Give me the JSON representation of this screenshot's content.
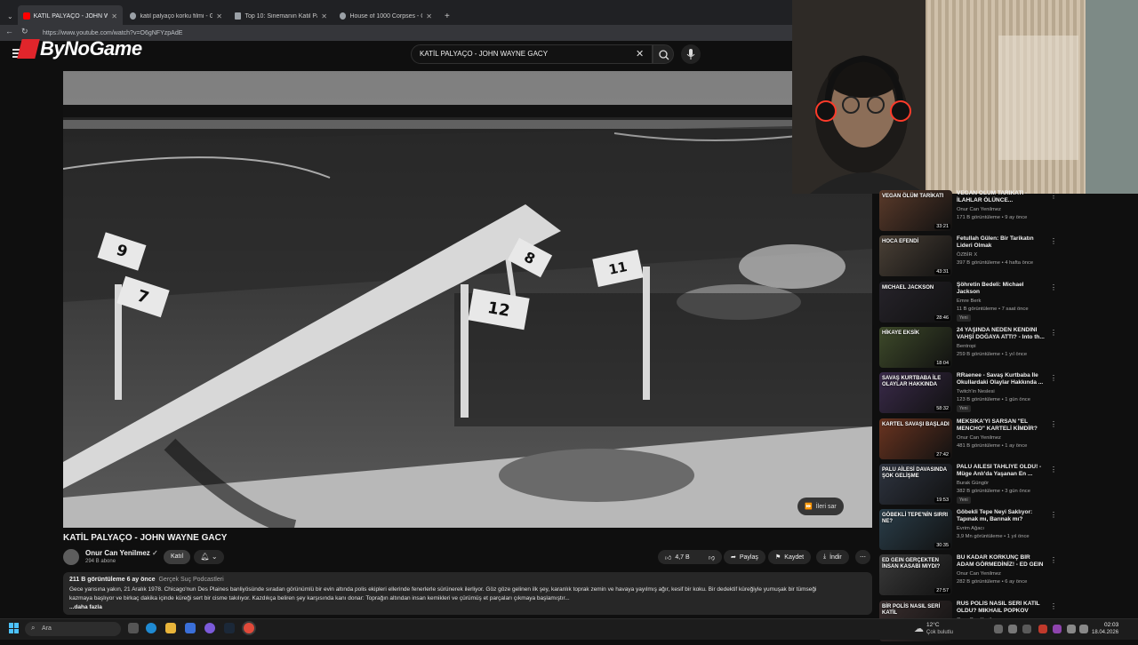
{
  "browser": {
    "tabs": [
      {
        "label": "KATİL PALYAÇO - JOHN WAYNE G",
        "active": true,
        "icon": "youtube-icon"
      },
      {
        "label": "katil palyaço korku filmi - Google",
        "active": false,
        "icon": "google-icon"
      },
      {
        "label": "Top 10: Sinemanın Katil Palyaçola",
        "active": false,
        "icon": "page-icon"
      },
      {
        "label": "House of 1000 Corpses - Google",
        "active": false,
        "icon": "google-icon"
      }
    ],
    "url": "https://www.youtube.com/watch?v=O6gNFYzpAdE"
  },
  "header": {
    "logo_text": "ByNoGame",
    "search_query": "KATİL PALYAÇO - JOHN WAYNE GACY"
  },
  "video": {
    "markers": [
      "9",
      "7",
      "8",
      "12",
      "11"
    ],
    "skip_label": "İleri sar",
    "title": "KATİL PALYAÇO - JOHN WAYNE GACY"
  },
  "channel": {
    "name": "Onur Can Yenilmez",
    "subscribers": "294 B abone",
    "join_label": "Katıl"
  },
  "actions": {
    "likes": "4,7 B",
    "share": "Paylaş",
    "save": "Kaydet",
    "download": "İndir"
  },
  "description": {
    "views_time": "211 B görüntüleme  6 ay önce",
    "tag": "Gerçek Suç Podcastleri",
    "line1": "Gece yarısına yakın, 21 Aralık 1978. Chicago'nun Des Plaines banliyösünde sıradan görünümlü bir evin altında polis ekipleri ellerinde fenerlerle sürünerek ilerliyor. Göz göze gelinen ilk şey, karanlık toprak zemin ve havaya yayılmış ağır, kesif bir koku. Bir dedektif küreğiyle yumuşak bir tümseği",
    "line2": "kazmaya başlıyor ve birkaç dakika içinde küreği sert bir cisme takılıyor. Kazdıkça beliren şey karşısında kanı donar: Toprağın altından insan kemikleri ve çürümüş et parçaları çıkmaya başlamıştır...",
    "more": "...daha fazla"
  },
  "recommendations": [
    {
      "title": "VEGAN ÖLÜM TARİKATI - İLAHLAR ÖLÜNCE...",
      "thumb_text": "VEGAN ÖLÜM TARİKATI",
      "channel": "Onur Can Yenilmez",
      "meta": "171 B görüntüleme • 9 ay önce",
      "duration": "33:21",
      "new": "",
      "color": "#5a3a2a"
    },
    {
      "title": "Fetullah Gülen: Bir Tarikatın Lideri Olmak",
      "thumb_text": "HOCA EFENDİ",
      "channel": "ÖZBİR X",
      "meta": "397 B görüntüleme • 4 hafta önce",
      "duration": "43:31",
      "new": "",
      "color": "#4a4036"
    },
    {
      "title": "Şöhretin Bedeli: Michael Jackson",
      "thumb_text": "MICHAEL JACKSON",
      "channel": "Emre Berk",
      "meta": "11 B görüntüleme • 7 saat önce",
      "duration": "28:46",
      "new": "Yeni",
      "color": "#26232a"
    },
    {
      "title": "24 YAŞINDA NEDEN KENDİNİ VAHŞİ DOĞAYA ATTI? - Into th...",
      "thumb_text": "HİKAYE EKSİK",
      "channel": "Bentropi",
      "meta": "259 B görüntüleme • 1 yıl önce",
      "duration": "18:04",
      "new": "",
      "color": "#3e4a2a"
    },
    {
      "title": "RRaenee - Savaş Kurtbaba İle Okullardaki Olaylar Hakkında ...",
      "thumb_text": "SAVAŞ KURTBABA İLE OLAYLAR HAKKINDA",
      "channel": "Twitch'in Neslesi",
      "meta": "123 B görüntüleme • 1 gün önce",
      "duration": "58:32",
      "new": "Yeni",
      "color": "#3a2a4a"
    },
    {
      "title": "MEKSİKA'YI SARSAN \"EL MENCHO\" KARTELİ KİMDİR?",
      "thumb_text": "KARTEL SAVAŞI BAŞLADI",
      "channel": "Onur Can Yenilmez",
      "meta": "481 B görüntüleme • 1 ay önce",
      "duration": "27:42",
      "new": "",
      "color": "#6a3420"
    },
    {
      "title": "PALU AİLESİ TAHLİYE OLDU! - Müge Anlı'da Yaşanan En ...",
      "thumb_text": "PALU AİLESİ DAVASINDA ŞOK GELİŞME",
      "channel": "Burak Güngör",
      "meta": "382 B görüntüleme • 3 gün önce",
      "duration": "19:53",
      "new": "Yeni",
      "color": "#2e3440"
    },
    {
      "title": "Göbekli Tepe Neyi Saklıyor: Tapınak mı, Barınak mı?",
      "thumb_text": "GÖBEKLİ TEPE'NİN SIRRI NE?",
      "channel": "Evrim Ağacı",
      "meta": "3,9 Mn görüntüleme • 1 yıl önce",
      "duration": "30:35",
      "new": "",
      "color": "#2a3e4a"
    },
    {
      "title": "BU KADAR KORKUNÇ BİR ADAM GÖRMEDİNİZ! - ED GEIN",
      "thumb_text": "ED GEIN GERÇEKTEN İNSAN KASABI MIYDI?",
      "channel": "Onur Can Yenilmez",
      "meta": "282 B görüntüleme • 6 ay önce",
      "duration": "27:57",
      "new": "",
      "color": "#3a3a3a"
    },
    {
      "title": "RUS POLİS NASIL SERİ KATİL OLDU? MIKHAIL POPKOV",
      "thumb_text": "BİR POLİS NASIL SERİ KATİL",
      "channel": "Onur Can Yenilmez",
      "meta": "",
      "duration": "",
      "new": "",
      "color": "#3a2e2e"
    }
  ],
  "taskbar": {
    "search_placeholder": "Ara",
    "weather_temp": "12°C",
    "weather_desc": "Çok bulutlu",
    "time": "02:03",
    "date": "18.04.2026"
  }
}
